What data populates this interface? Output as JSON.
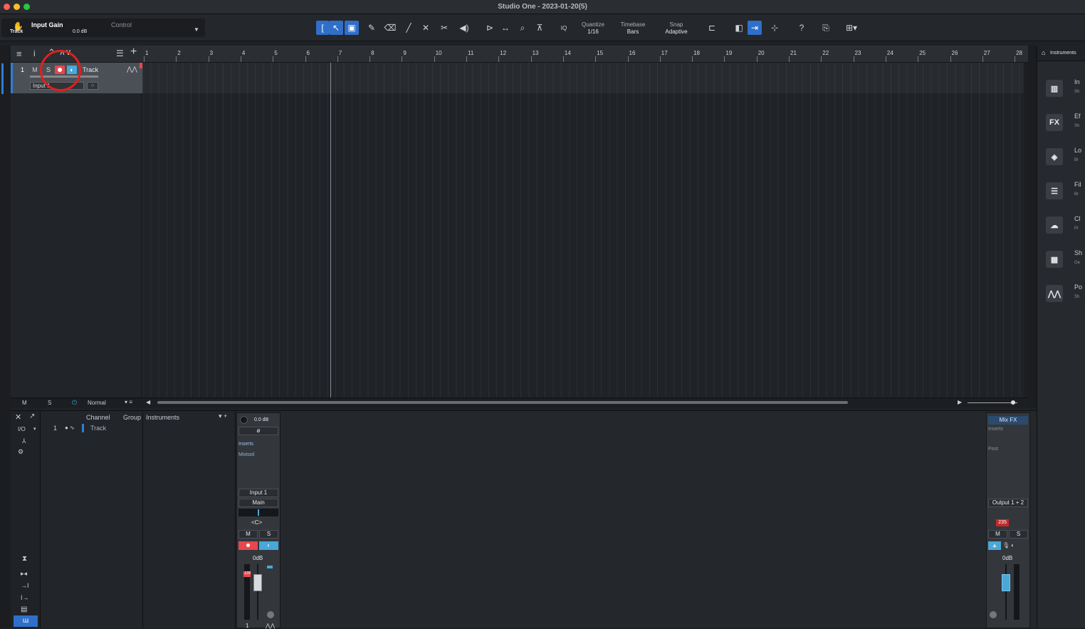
{
  "window": {
    "title": "Studio One - 2023-01-20(5)"
  },
  "control_panel": {
    "name": "Input Gain",
    "sub": "Track",
    "value": "0.0 dB",
    "mode_label": "Control"
  },
  "toolbar": {
    "quantize_label": "Quantize",
    "quantize_value": "1/16",
    "timebase_label": "Timebase",
    "timebase_value": "Bars",
    "snap_label": "Snap",
    "snap_value": "Adaptive",
    "iq_label": "IQ",
    "help_label": "?"
  },
  "tracks": [
    {
      "number": "1",
      "mute": "M",
      "solo": "S",
      "name": "Track",
      "input": "Input 1"
    }
  ],
  "ruler": {
    "bars": [
      "1",
      "2",
      "3",
      "4",
      "5",
      "6",
      "7",
      "8",
      "9",
      "10",
      "11",
      "12",
      "13",
      "14",
      "15",
      "16",
      "17",
      "18",
      "19",
      "20",
      "21",
      "22",
      "23",
      "24",
      "25",
      "26",
      "27",
      "28"
    ]
  },
  "track_footer": {
    "m": "M",
    "s": "S",
    "mode": "Normal"
  },
  "mixer": {
    "io_label": "I/O",
    "columns": {
      "channel": "Channel",
      "group": "Group"
    },
    "list": [
      {
        "number": "1",
        "name": "Track"
      }
    ],
    "instruments_label": "Instruments",
    "strip": {
      "gain": "0.0 dB",
      "phase": "ø",
      "inserts": "Inserts",
      "insert_1": "Mixtool",
      "input": "Input 1",
      "output": "Main",
      "pan": "<C>",
      "m": "M",
      "s": "S",
      "level": "0dB",
      "peak": "-228",
      "number": "1"
    },
    "master": {
      "mixfx": "Mix FX",
      "inserts": "Inserts",
      "post": "Post",
      "output": "Output 1 + 2",
      "peak": "235",
      "m": "M",
      "s": "S",
      "level": "0dB"
    }
  },
  "browser": {
    "tab": "Instruments",
    "items": [
      {
        "short": "In",
        "sub": "Sh"
      },
      {
        "short": "Ef",
        "sub": "Sh"
      },
      {
        "short": "Lo",
        "sub": "Br"
      },
      {
        "short": "Fil",
        "sub": "Br"
      },
      {
        "short": "Cl",
        "sub": "Pr"
      },
      {
        "short": "Sh",
        "sub": "Ge"
      },
      {
        "short": "Po",
        "sub": "Sh"
      }
    ]
  },
  "colors": {
    "accent": "#2f6fc9",
    "record": "#e5484d",
    "monitor": "#4aa8d8",
    "annotation": "#e0201c"
  }
}
